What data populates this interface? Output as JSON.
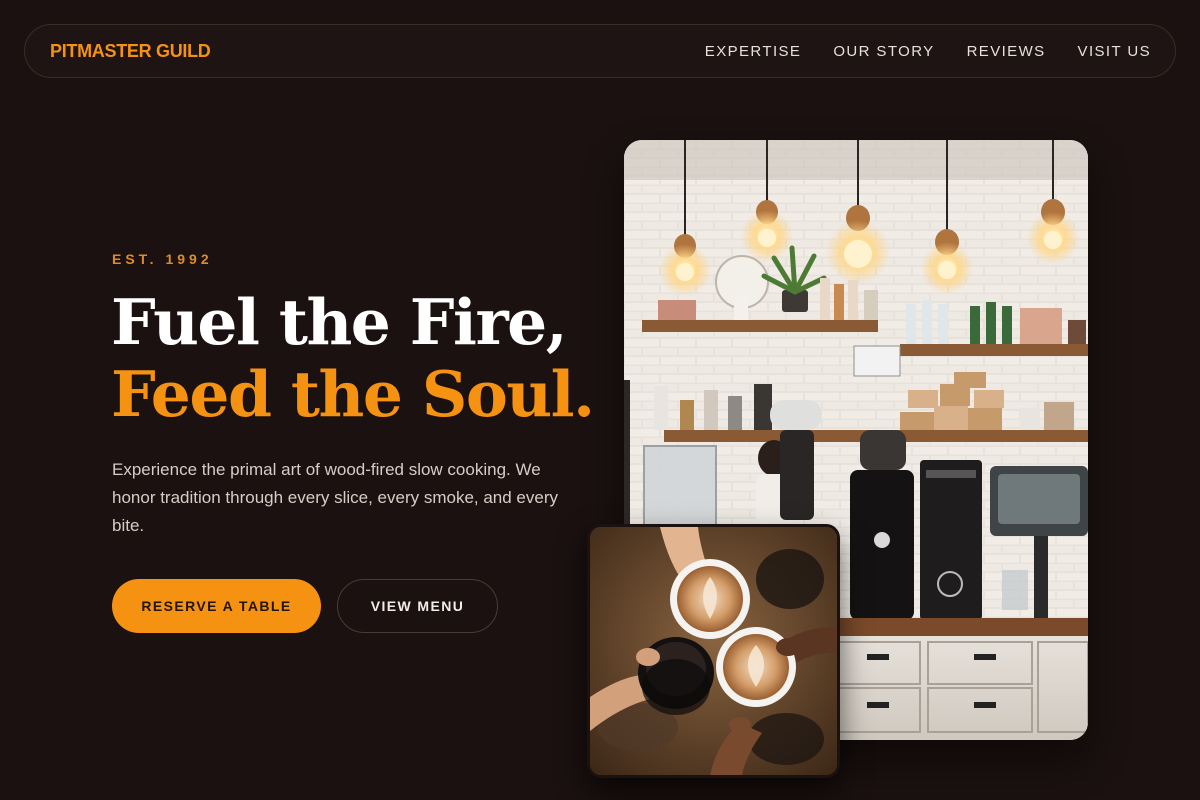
{
  "nav": {
    "brand": "PITMASTER GUILD",
    "links": [
      "EXPERTISE",
      "OUR STORY",
      "REVIEWS",
      "VISIT US"
    ]
  },
  "hero": {
    "eyebrow": "EST. 1992",
    "headline_line1": "Fuel the Fire,",
    "headline_line2": "Feed the Soul.",
    "description": "Experience the primal art of wood-fired slow cooking. We honor tradition through every slice, every smoke, and every bite.",
    "primary_cta": "RESERVE A TABLE",
    "secondary_cta": "VIEW MENU"
  },
  "colors": {
    "background": "#1a1110",
    "accent": "#f59212",
    "text": "#e9e2dc"
  },
  "images": {
    "main": "coffee-shop-counter-photo",
    "inset": "latte-cheers-photo"
  }
}
